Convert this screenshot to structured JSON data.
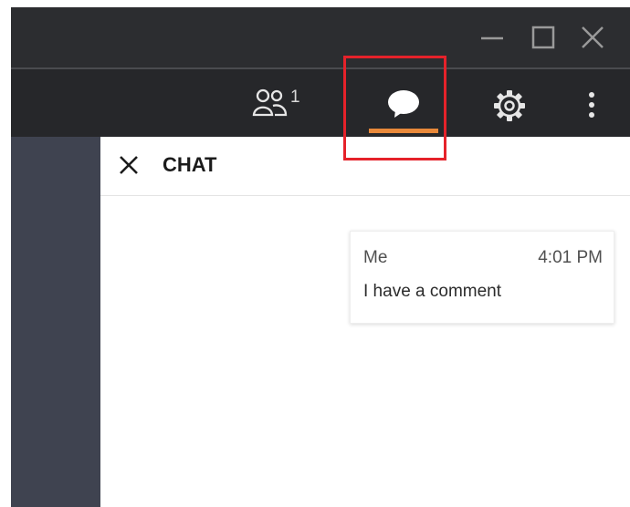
{
  "window_controls": {
    "minimize_icon": "minimize-icon",
    "maximize_icon": "maximize-icon",
    "close_icon": "close-icon"
  },
  "toolbar": {
    "participants": {
      "icon": "participants-icon",
      "count": "1"
    },
    "chat": {
      "icon": "chat-bubble-icon",
      "active": true
    },
    "settings": {
      "icon": "gear-icon"
    },
    "more": {
      "icon": "more-vertical-icon"
    }
  },
  "chat_panel": {
    "title": "CHAT",
    "close_icon": "close-icon",
    "messages": [
      {
        "sender": "Me",
        "time": "4:01 PM",
        "text": "I have a comment"
      }
    ]
  },
  "colors": {
    "titlebar_bg": "#2c2d30",
    "toolbar_bg": "#26272a",
    "active_indicator": "#e9893a",
    "highlight_box": "#e5222a",
    "sidebar_bg": "#3f4350"
  }
}
